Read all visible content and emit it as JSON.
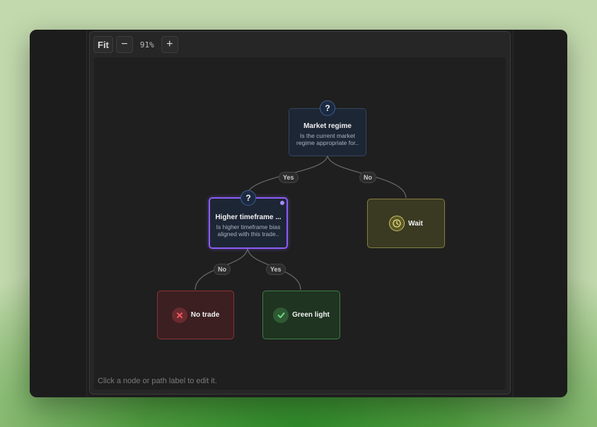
{
  "toolbar": {
    "fit_label": "Fit",
    "zoom_out_label": "−",
    "zoom_level": "91%",
    "zoom_in_label": "+"
  },
  "nodes": {
    "market_regime": {
      "badge": "?",
      "title": "Market regime",
      "desc_line1": "Is the current market",
      "desc_line2": "regime appropriate for.."
    },
    "higher_timeframe": {
      "badge": "?",
      "title": "Higher timeframe ...",
      "desc_line1": "Is higher timeframe bias",
      "desc_line2": "aligned with this trade.."
    },
    "wait": {
      "icon": "clock-icon",
      "label": "Wait"
    },
    "no_trade": {
      "icon": "x-icon",
      "label": "No trade"
    },
    "green_light": {
      "icon": "check-icon",
      "label": "Green light"
    }
  },
  "edge_labels": {
    "regime_yes": "Yes",
    "regime_no": "No",
    "htf_no": "No",
    "htf_yes": "Yes"
  },
  "hint": "Click a node or path label to edit it.",
  "colors": {
    "selected_border": "#8b5cf6",
    "wait_border": "#857f3f",
    "no_trade_border": "#8c3238",
    "green_light_border": "#3e7f45"
  }
}
